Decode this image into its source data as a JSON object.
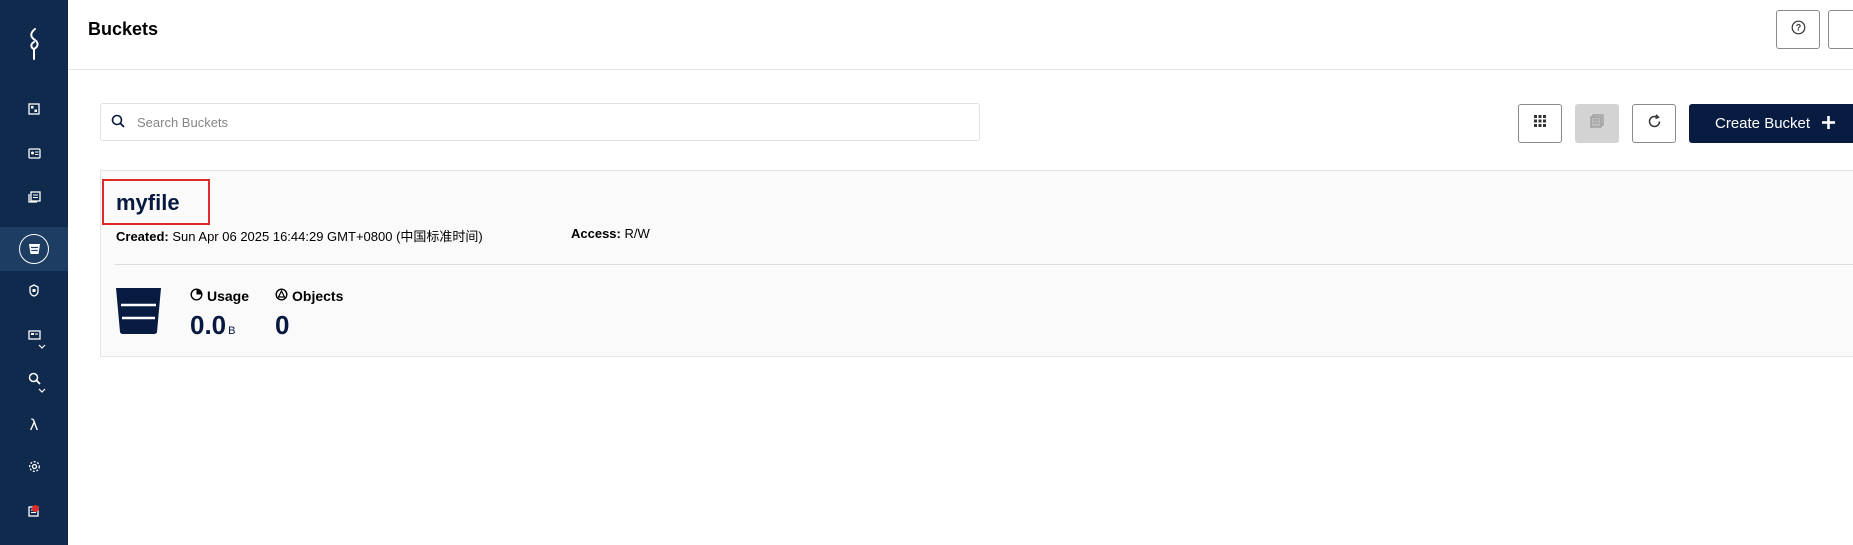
{
  "header": {
    "title": "Buckets"
  },
  "search": {
    "placeholder": "Search Buckets",
    "value": ""
  },
  "toolbar": {
    "create_label": "Create Bucket"
  },
  "sidebar": {
    "items": [
      {
        "icon": "dashboard-icon",
        "active": false
      },
      {
        "icon": "identity-icon",
        "active": false
      },
      {
        "icon": "logs-icon",
        "active": false
      },
      {
        "icon": "buckets-icon",
        "active": true
      },
      {
        "icon": "policies-icon",
        "active": false
      },
      {
        "icon": "monitoring-icon",
        "active": false,
        "expandable": true
      },
      {
        "icon": "search-trace-icon",
        "active": false,
        "expandable": true
      },
      {
        "icon": "lambda-icon",
        "active": false
      },
      {
        "icon": "settings-icon",
        "active": false
      },
      {
        "icon": "license-icon",
        "active": false,
        "badge": true
      }
    ]
  },
  "bucket": {
    "name": "myfile",
    "created_label": "Created:",
    "created_value": "Sun Apr 06 2025 16:44:29 GMT+0800 (中国标准时间)",
    "access_label": "Access:",
    "access_value": "R/W",
    "usage_label": "Usage",
    "usage_value": "0.0",
    "usage_unit": "B",
    "objects_label": "Objects",
    "objects_value": "0"
  },
  "colors": {
    "sidebar": "#0f2a4c",
    "primary": "#081c42",
    "highlight": "#e02a2a"
  }
}
